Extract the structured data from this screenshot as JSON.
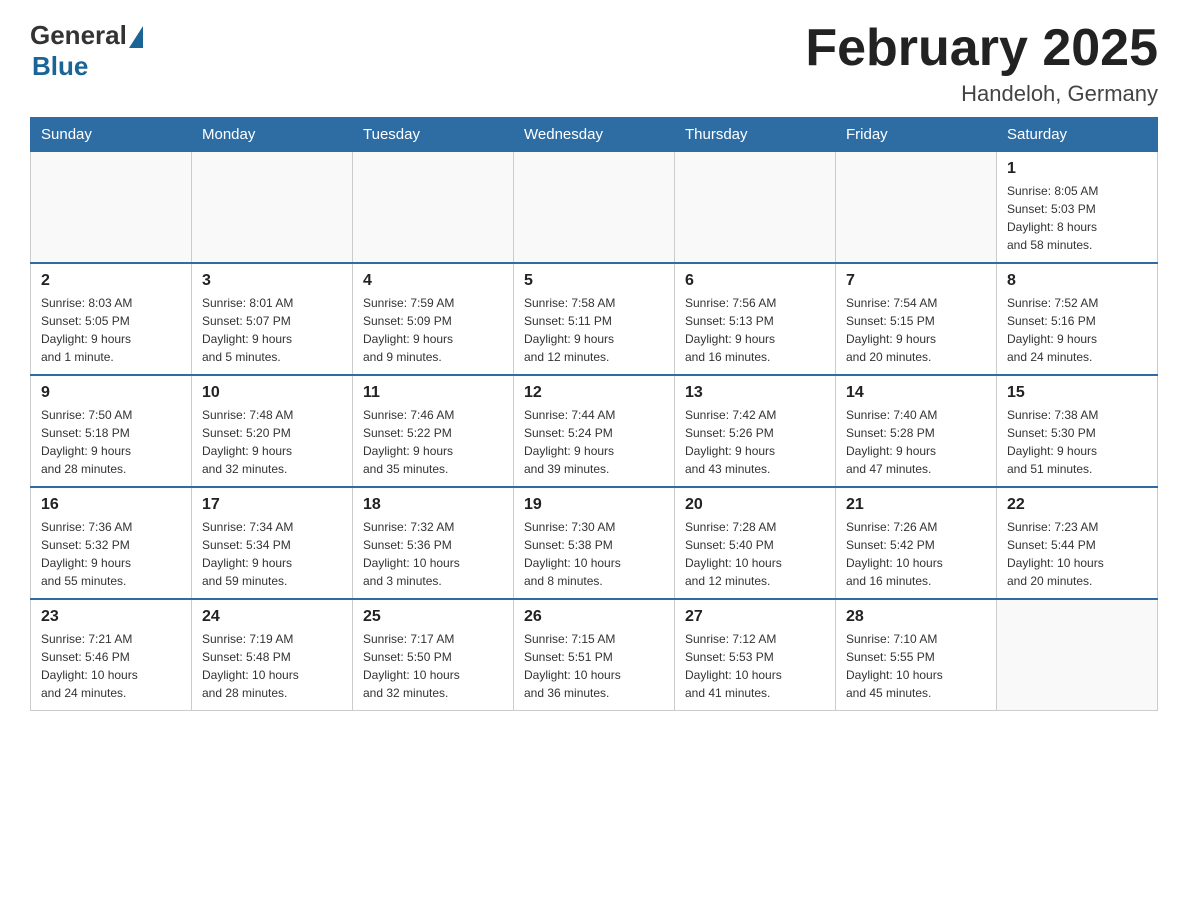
{
  "header": {
    "logo_general": "General",
    "logo_blue": "Blue",
    "title": "February 2025",
    "location": "Handeloh, Germany"
  },
  "days_of_week": [
    "Sunday",
    "Monday",
    "Tuesday",
    "Wednesday",
    "Thursday",
    "Friday",
    "Saturday"
  ],
  "weeks": [
    [
      {
        "day": "",
        "info": ""
      },
      {
        "day": "",
        "info": ""
      },
      {
        "day": "",
        "info": ""
      },
      {
        "day": "",
        "info": ""
      },
      {
        "day": "",
        "info": ""
      },
      {
        "day": "",
        "info": ""
      },
      {
        "day": "1",
        "info": "Sunrise: 8:05 AM\nSunset: 5:03 PM\nDaylight: 8 hours\nand 58 minutes."
      }
    ],
    [
      {
        "day": "2",
        "info": "Sunrise: 8:03 AM\nSunset: 5:05 PM\nDaylight: 9 hours\nand 1 minute."
      },
      {
        "day": "3",
        "info": "Sunrise: 8:01 AM\nSunset: 5:07 PM\nDaylight: 9 hours\nand 5 minutes."
      },
      {
        "day": "4",
        "info": "Sunrise: 7:59 AM\nSunset: 5:09 PM\nDaylight: 9 hours\nand 9 minutes."
      },
      {
        "day": "5",
        "info": "Sunrise: 7:58 AM\nSunset: 5:11 PM\nDaylight: 9 hours\nand 12 minutes."
      },
      {
        "day": "6",
        "info": "Sunrise: 7:56 AM\nSunset: 5:13 PM\nDaylight: 9 hours\nand 16 minutes."
      },
      {
        "day": "7",
        "info": "Sunrise: 7:54 AM\nSunset: 5:15 PM\nDaylight: 9 hours\nand 20 minutes."
      },
      {
        "day": "8",
        "info": "Sunrise: 7:52 AM\nSunset: 5:16 PM\nDaylight: 9 hours\nand 24 minutes."
      }
    ],
    [
      {
        "day": "9",
        "info": "Sunrise: 7:50 AM\nSunset: 5:18 PM\nDaylight: 9 hours\nand 28 minutes."
      },
      {
        "day": "10",
        "info": "Sunrise: 7:48 AM\nSunset: 5:20 PM\nDaylight: 9 hours\nand 32 minutes."
      },
      {
        "day": "11",
        "info": "Sunrise: 7:46 AM\nSunset: 5:22 PM\nDaylight: 9 hours\nand 35 minutes."
      },
      {
        "day": "12",
        "info": "Sunrise: 7:44 AM\nSunset: 5:24 PM\nDaylight: 9 hours\nand 39 minutes."
      },
      {
        "day": "13",
        "info": "Sunrise: 7:42 AM\nSunset: 5:26 PM\nDaylight: 9 hours\nand 43 minutes."
      },
      {
        "day": "14",
        "info": "Sunrise: 7:40 AM\nSunset: 5:28 PM\nDaylight: 9 hours\nand 47 minutes."
      },
      {
        "day": "15",
        "info": "Sunrise: 7:38 AM\nSunset: 5:30 PM\nDaylight: 9 hours\nand 51 minutes."
      }
    ],
    [
      {
        "day": "16",
        "info": "Sunrise: 7:36 AM\nSunset: 5:32 PM\nDaylight: 9 hours\nand 55 minutes."
      },
      {
        "day": "17",
        "info": "Sunrise: 7:34 AM\nSunset: 5:34 PM\nDaylight: 9 hours\nand 59 minutes."
      },
      {
        "day": "18",
        "info": "Sunrise: 7:32 AM\nSunset: 5:36 PM\nDaylight: 10 hours\nand 3 minutes."
      },
      {
        "day": "19",
        "info": "Sunrise: 7:30 AM\nSunset: 5:38 PM\nDaylight: 10 hours\nand 8 minutes."
      },
      {
        "day": "20",
        "info": "Sunrise: 7:28 AM\nSunset: 5:40 PM\nDaylight: 10 hours\nand 12 minutes."
      },
      {
        "day": "21",
        "info": "Sunrise: 7:26 AM\nSunset: 5:42 PM\nDaylight: 10 hours\nand 16 minutes."
      },
      {
        "day": "22",
        "info": "Sunrise: 7:23 AM\nSunset: 5:44 PM\nDaylight: 10 hours\nand 20 minutes."
      }
    ],
    [
      {
        "day": "23",
        "info": "Sunrise: 7:21 AM\nSunset: 5:46 PM\nDaylight: 10 hours\nand 24 minutes."
      },
      {
        "day": "24",
        "info": "Sunrise: 7:19 AM\nSunset: 5:48 PM\nDaylight: 10 hours\nand 28 minutes."
      },
      {
        "day": "25",
        "info": "Sunrise: 7:17 AM\nSunset: 5:50 PM\nDaylight: 10 hours\nand 32 minutes."
      },
      {
        "day": "26",
        "info": "Sunrise: 7:15 AM\nSunset: 5:51 PM\nDaylight: 10 hours\nand 36 minutes."
      },
      {
        "day": "27",
        "info": "Sunrise: 7:12 AM\nSunset: 5:53 PM\nDaylight: 10 hours\nand 41 minutes."
      },
      {
        "day": "28",
        "info": "Sunrise: 7:10 AM\nSunset: 5:55 PM\nDaylight: 10 hours\nand 45 minutes."
      },
      {
        "day": "",
        "info": ""
      }
    ]
  ]
}
